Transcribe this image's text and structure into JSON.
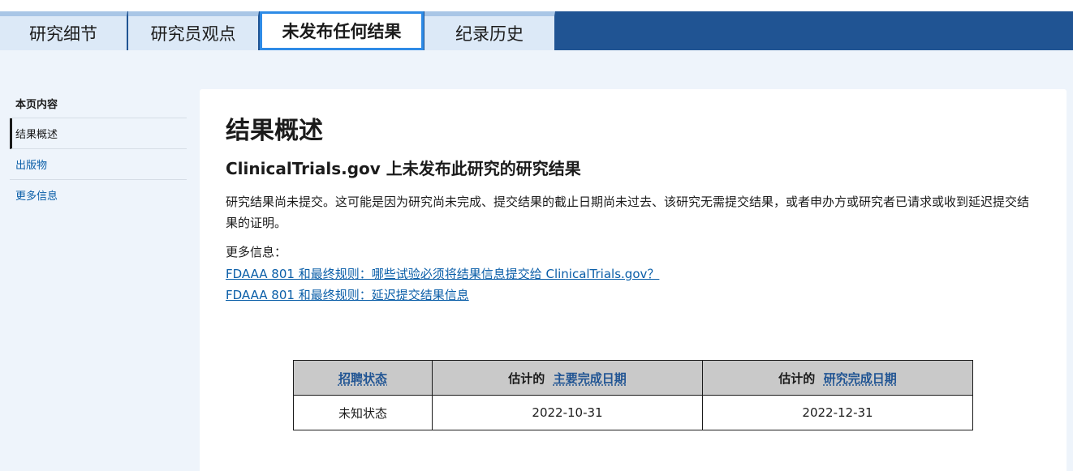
{
  "tabs": [
    {
      "label": "研究细节"
    },
    {
      "label": "研究员观点"
    },
    {
      "label": "未发布任何结果"
    },
    {
      "label": "纪录历史"
    }
  ],
  "sidebar": {
    "heading": "本页内容",
    "items": [
      {
        "label": "结果概述"
      },
      {
        "label": "出版物"
      },
      {
        "label": "更多信息"
      }
    ]
  },
  "main": {
    "title": "结果概述",
    "subtitle": "ClinicalTrials.gov 上未发布此研究的研究结果",
    "paragraph": "研究结果尚未提交。这可能是因为研究尚未完成、提交结果的截止日期尚未过去、该研究无需提交结果，或者申办方或研究者已请求或收到延迟提交结果的证明。",
    "more_info_label": "更多信息：",
    "links": [
      {
        "label": "FDAAA 801 和最终规则：哪些试验必须将结果信息提交给 ClinicalTrials.gov？"
      },
      {
        "label": "FDAAA 801 和最终规则：延迟提交结果信息"
      }
    ]
  },
  "status_table": {
    "headers": [
      {
        "prefix": "",
        "link": "招聘状态"
      },
      {
        "prefix": "估计的",
        "link": "主要完成日期"
      },
      {
        "prefix": "估计的",
        "link": "研究完成日期"
      }
    ],
    "row": [
      "未知状态",
      "2022-10-31",
      "2022-12-31"
    ]
  },
  "colors": {
    "tab_bar": "#205493",
    "tab_bg": "#dce9f7",
    "active_border": "#2e8be6",
    "link": "#0a5ea8",
    "page_bg": "#eef4fb"
  }
}
